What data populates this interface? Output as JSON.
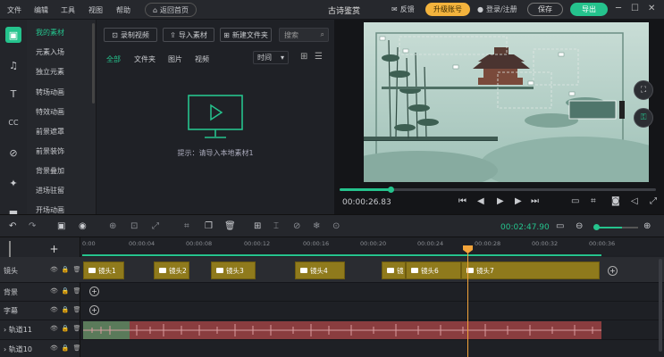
{
  "menu": [
    "文件",
    "编辑",
    "工具",
    "视图",
    "帮助"
  ],
  "header": {
    "back_home": "返回首页",
    "title": "古诗鉴赏",
    "feedback": "反馈",
    "upgrade": "升级账号",
    "login": "登录/注册",
    "save": "保存",
    "export": "导出"
  },
  "categories": [
    "我的素材",
    "元素入场",
    "独立元素",
    "转场动画",
    "特效动画",
    "前景遮罩",
    "前景装饰",
    "背景叠加",
    "进场驻留",
    "开场动画"
  ],
  "media": {
    "record": "录制视频",
    "import": "导入素材",
    "new_folder": "新建文件夹",
    "search_placeholder": "搜索",
    "tabs": [
      "全部",
      "文件夹",
      "图片",
      "视频"
    ],
    "sort": "时间",
    "empty_hint": "提示：请导入本地素材1"
  },
  "preview": {
    "current_time": "00:00:26.83",
    "progress": 0.16
  },
  "timeline": {
    "total_time": "00:02:47.90",
    "ruler": [
      "0:00",
      "00:00:04",
      "00:00:08",
      "00:00:12",
      "00:00:16",
      "00:00:20",
      "00:00:24",
      "00:00:28",
      "00:00:32",
      "00:00:36"
    ],
    "tracks": [
      "镜头",
      "背景",
      "字幕",
      "轨道11",
      "轨道10"
    ],
    "clips": [
      "镜头1",
      "镜头2",
      "镜头3",
      "镜头4",
      "镜",
      "镜头6",
      "镜头7"
    ]
  },
  "colors": {
    "accent": "#25c38d",
    "upgrade": "#f3b33d",
    "clip": "#8f7a1c",
    "audio": "#8a3d3f",
    "playhead": "#f3a43a"
  }
}
